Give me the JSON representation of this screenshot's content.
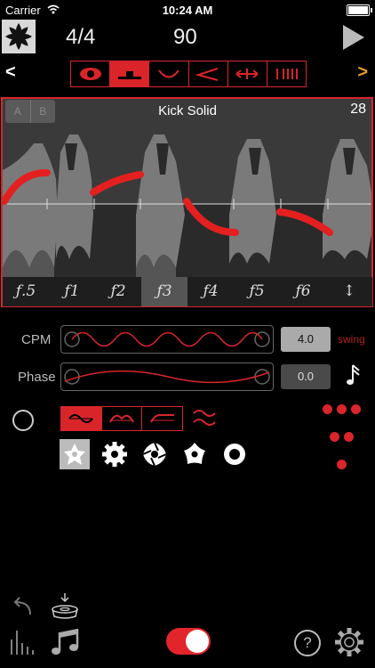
{
  "status": {
    "carrier": "Carrier",
    "time": "10:24 AM"
  },
  "header": {
    "time_signature": "4/4",
    "tempo": "90"
  },
  "navigation": {
    "prev": "<",
    "next": ">"
  },
  "modes": [
    "eye-icon",
    "flat-mode-icon",
    "curve-icon",
    "angle-icon",
    "stretch-icon",
    "bars-icon"
  ],
  "active_mode": 1,
  "panel": {
    "ab_left": "A",
    "ab_right": "B",
    "sound_name": "Kick Solid",
    "count": "28",
    "f_labels": [
      "ƒ.5",
      "ƒ1",
      "ƒ2",
      "ƒ3",
      "ƒ4",
      "ƒ5",
      "ƒ6",
      "↕"
    ],
    "selected_f": 3
  },
  "cpm": {
    "label": "CPM",
    "value": "4.0",
    "swing": "swing"
  },
  "phase": {
    "label": "Phase",
    "value": "0.0"
  },
  "wave_buttons": [
    "sine-wave-icon",
    "round-wave-icon",
    "ramp-wave-icon",
    "wave-alt-icon"
  ],
  "shape_icons": [
    "star-filled-icon",
    "gear-shape-icon",
    "swirl-shape-icon",
    "pentagon-star-icon",
    "ring-shape-icon"
  ],
  "colors": {
    "accent": "#d9252a",
    "orange": "#e89e28"
  }
}
